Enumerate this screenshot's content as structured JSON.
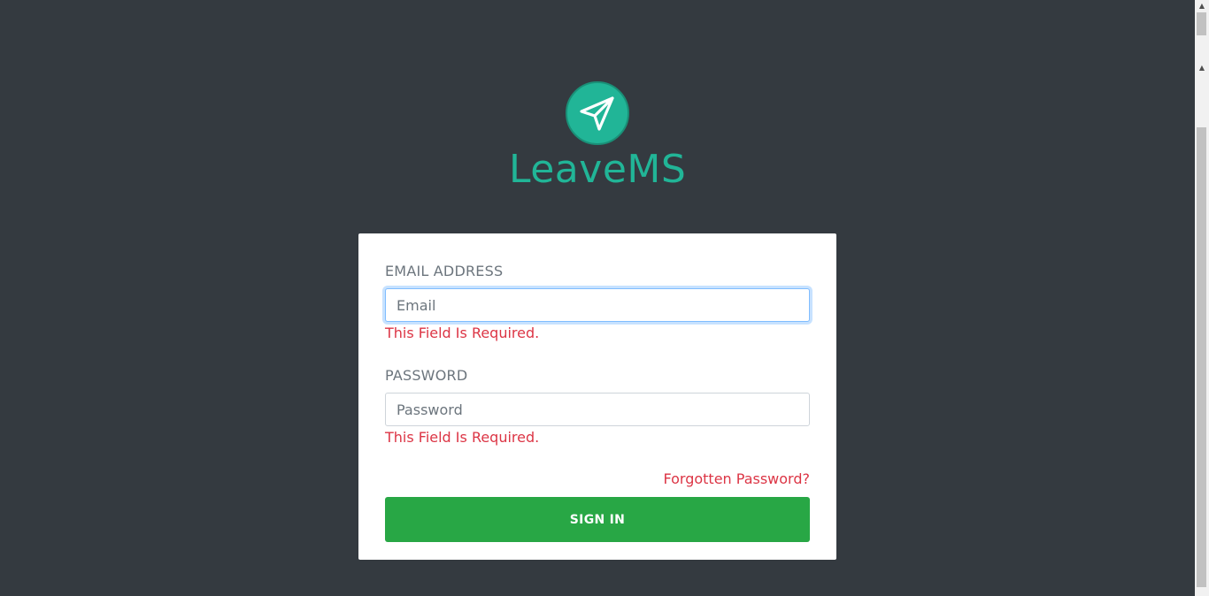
{
  "brand": {
    "name": "LeaveMS",
    "logo_icon": "paper-plane-icon",
    "color": "#21b597"
  },
  "form": {
    "email": {
      "label": "EMAIL ADDRESS",
      "placeholder": "Email",
      "value": "",
      "error": "This Field Is Required."
    },
    "password": {
      "label": "PASSWORD",
      "placeholder": "Password",
      "value": "",
      "error": "This Field Is Required."
    },
    "forgot_label": "Forgotten Password?",
    "submit_label": "SIGN IN"
  },
  "colors": {
    "background": "#343a40",
    "error": "#dc3545",
    "submit": "#28a745"
  }
}
